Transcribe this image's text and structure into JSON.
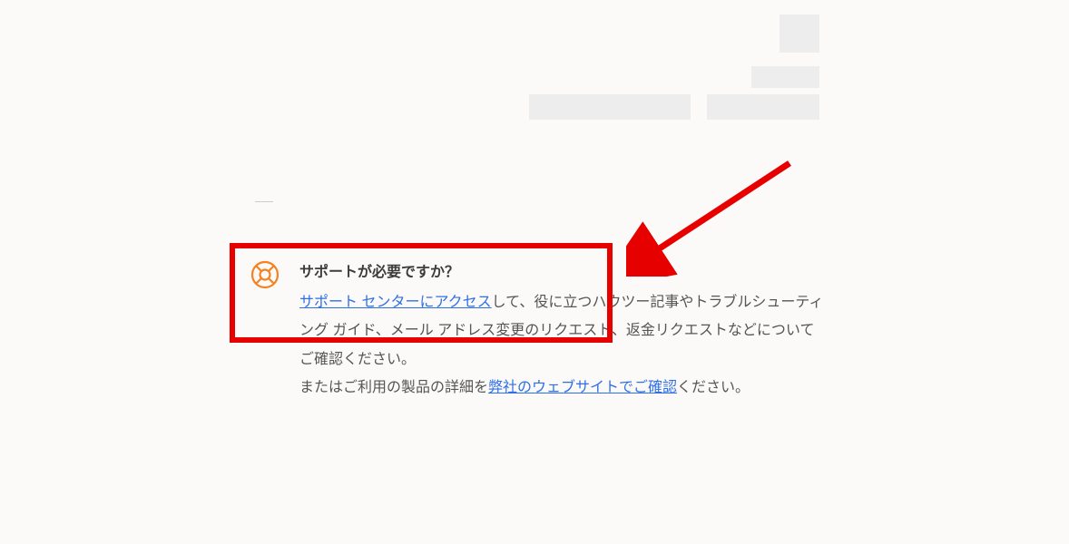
{
  "help": {
    "title": "サポートが必要ですか？",
    "link1_text": "サポート センターにアクセス",
    "text1": "して、役に立つハウツー記事やトラブルシューティング ガイド、メール アドレス変更のリクエスト、返金リクエストなどについてご確認ください。",
    "text2_prefix": "またはご利用の製品の詳細を",
    "link2_text": "弊社のウェブサイトでご確認",
    "text2_suffix": "ください。"
  }
}
